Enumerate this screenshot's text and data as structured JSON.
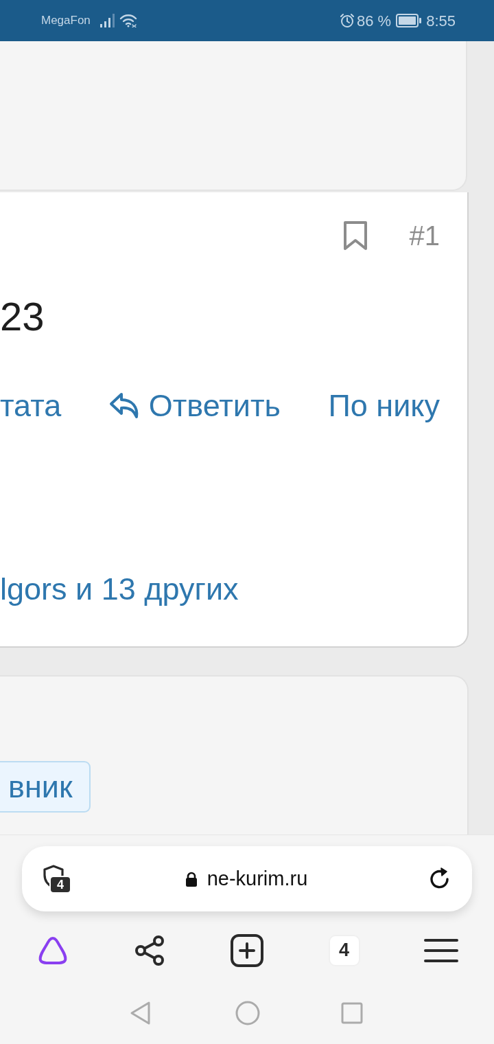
{
  "status_bar": {
    "carrier": "MegaFon",
    "battery": "86 %",
    "time": "8:55"
  },
  "post": {
    "number": "#1",
    "text": "23",
    "actions": [
      {
        "kind": "link",
        "label": "тата"
      },
      {
        "kind": "reply",
        "label": "Ответить"
      },
      {
        "kind": "link",
        "label": "По нику"
      }
    ],
    "reactions": "lgors и 13 других"
  },
  "next_post": {
    "tag": "вник"
  },
  "browser": {
    "tracker_count": "4",
    "url": "ne-kurim.ru",
    "tabs_count": "4"
  }
}
